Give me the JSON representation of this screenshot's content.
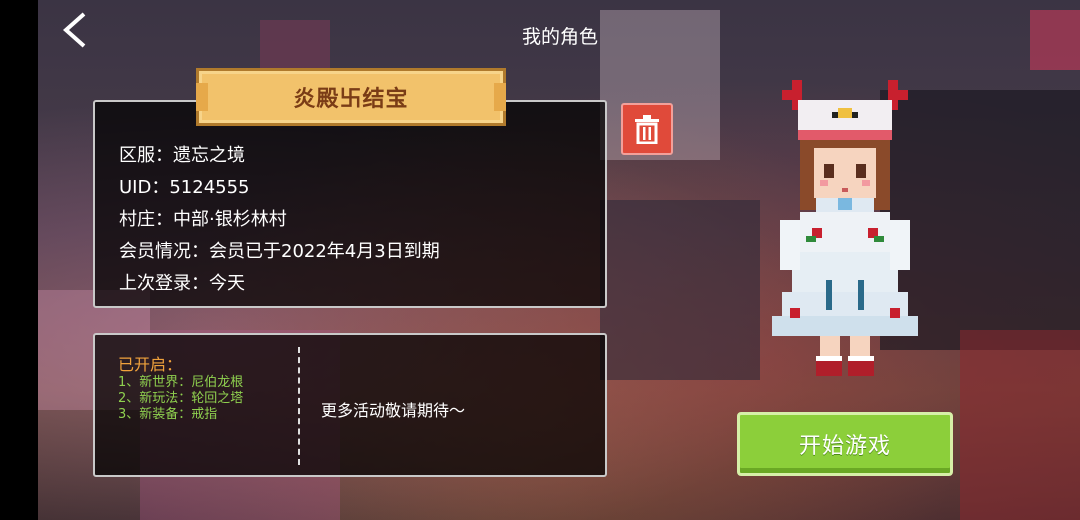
{
  "header": {
    "title": "我的角色",
    "back_icon": "chevron-left-icon"
  },
  "profile": {
    "name": "炎殿卐结宝",
    "lines": [
      "区服：遗忘之境",
      "UID：5124555",
      "村庄：中部·银杉林村",
      "会员情况：会员已于2022年4月3日到期",
      "上次登录：今天"
    ],
    "delete_icon": "trash-icon"
  },
  "activities": {
    "opened_label": "已开启：",
    "items": [
      "1、新世界：尼伯龙根",
      "2、新玩法：轮回之塔",
      "3、新装备：戒指"
    ],
    "more_text": "更多活动敬请期待～"
  },
  "actions": {
    "start_label": "开始游戏"
  },
  "colors": {
    "accent_orange": "#f0a23c",
    "feature_green": "#8fd14f",
    "start_green": "#8ccf3a",
    "delete_red": "#e04a3a",
    "plate_gold": "#f2c26b"
  }
}
